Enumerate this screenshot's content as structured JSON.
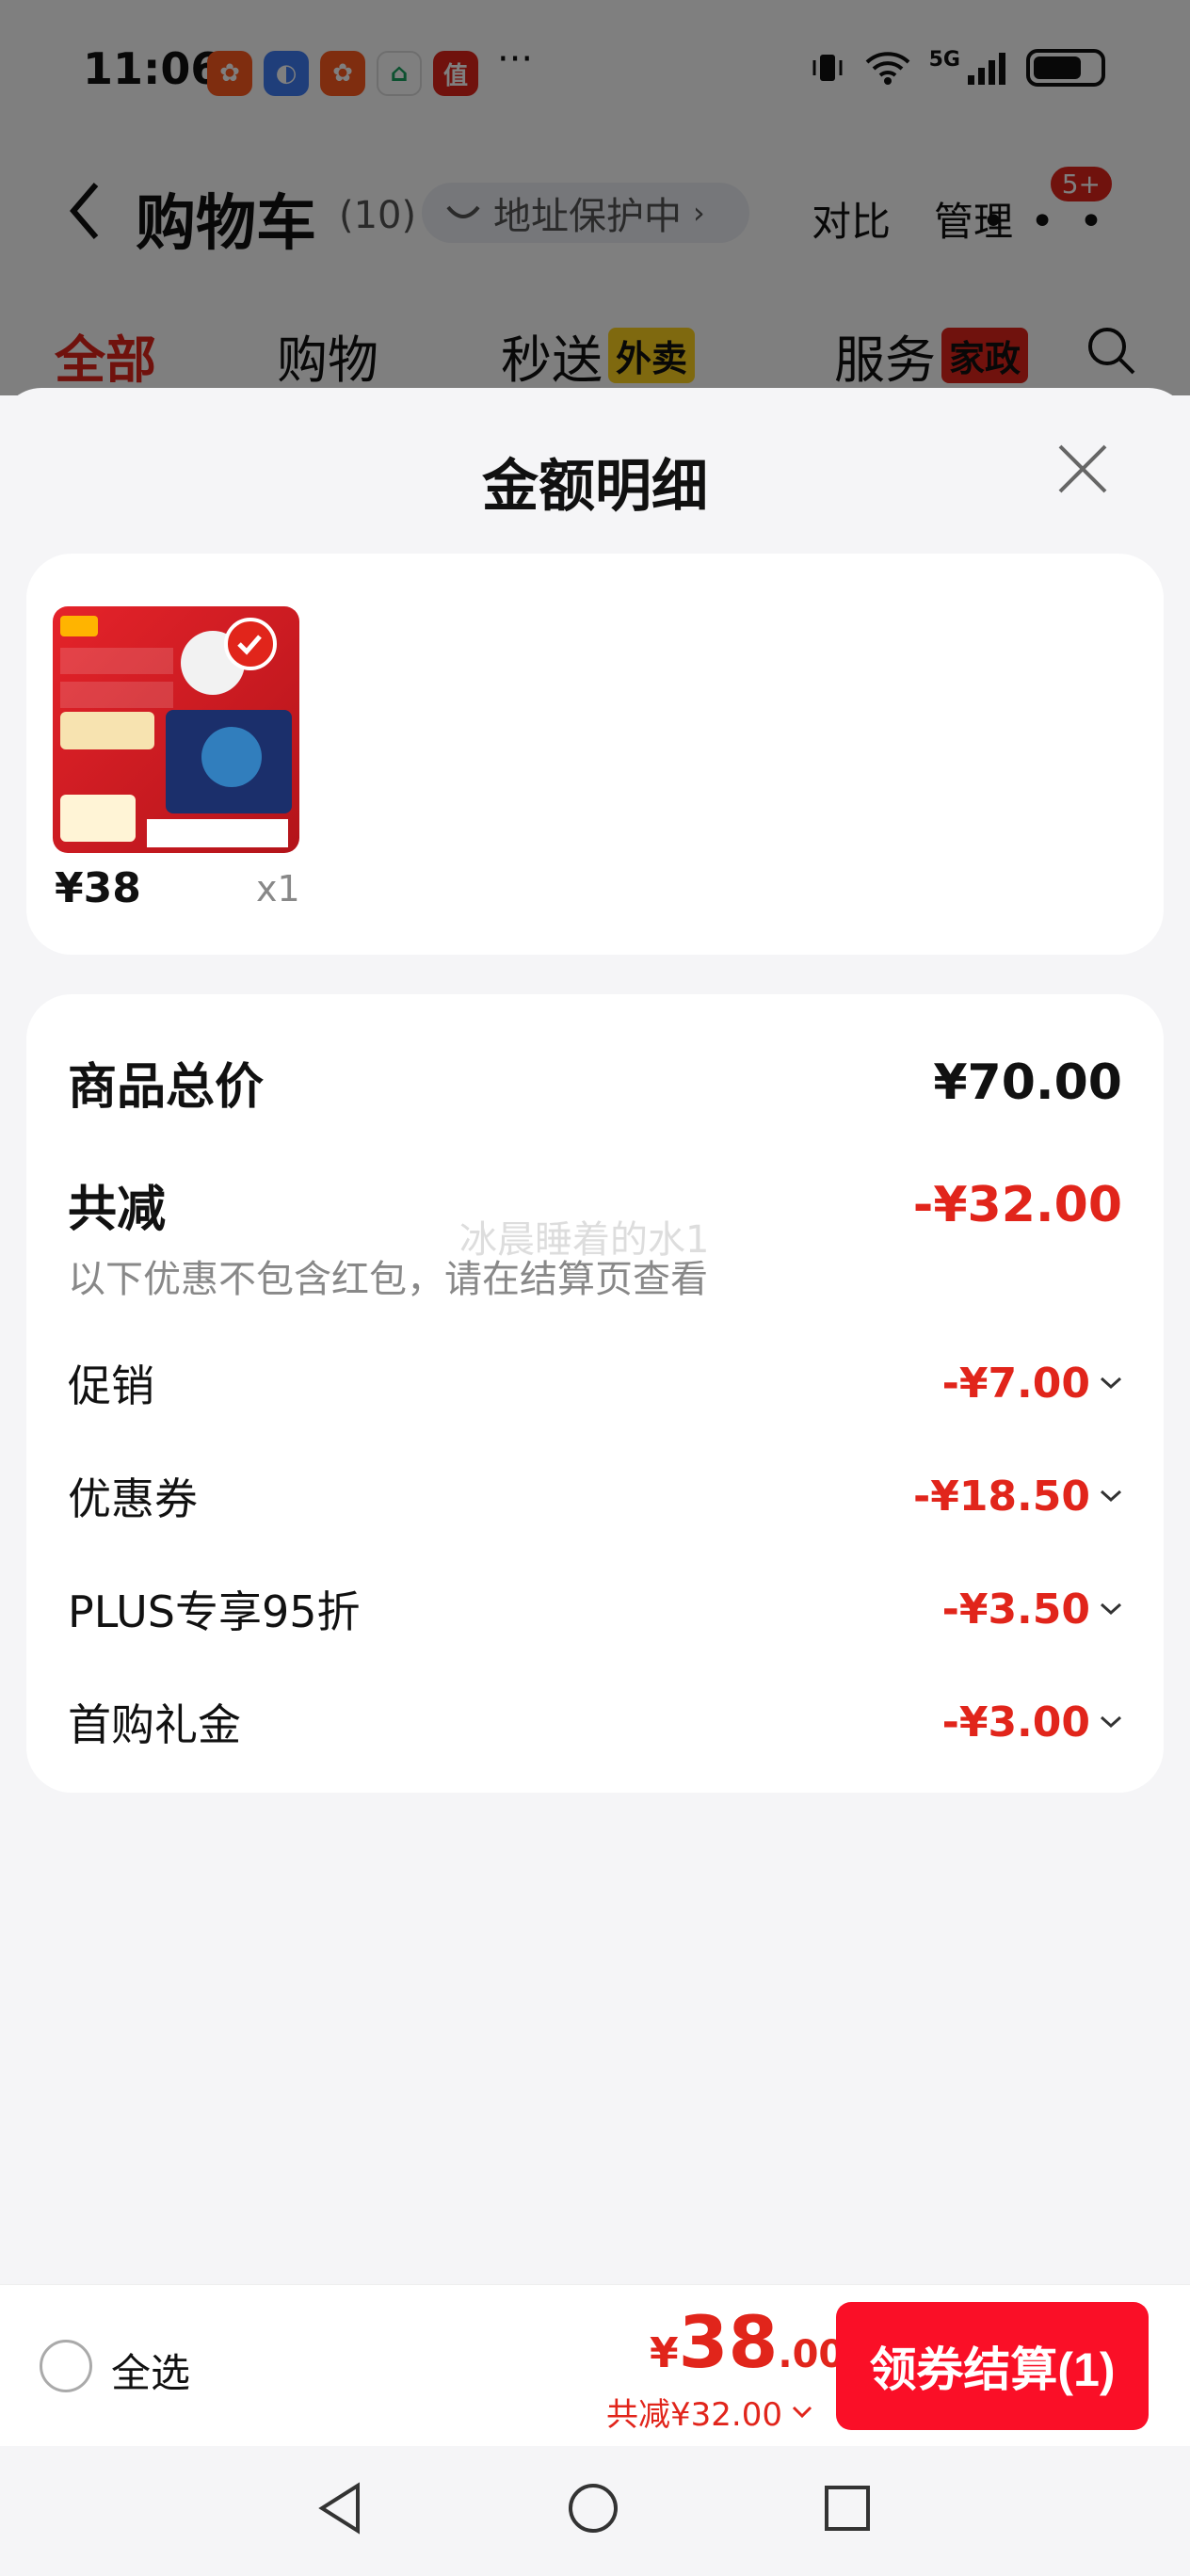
{
  "status_bar": {
    "time": "11:06",
    "more": "···",
    "network": "5G"
  },
  "header": {
    "title": "购物车",
    "count": "(10)",
    "address_protect": "地址保护中",
    "compare": "对比",
    "manage": "管理",
    "badge": "5+"
  },
  "tabs": [
    {
      "label": "全部"
    },
    {
      "label": "购物"
    },
    {
      "label": "秒送",
      "tag": "外卖"
    },
    {
      "label": "服务",
      "tag": "家政"
    }
  ],
  "sheet": {
    "title": "金额明细",
    "product": {
      "price": "¥38",
      "qty": "x1"
    },
    "watermark": "冰晨睡着的水1",
    "summary": {
      "total_label": "商品总价",
      "total_value": "¥70.00",
      "reduce_label": "共减",
      "reduce_value": "-¥32.00",
      "note": "以下优惠不包含红包，请在结算页查看"
    },
    "discounts": [
      {
        "label": "促销",
        "value": "-¥7.00"
      },
      {
        "label": "优惠券",
        "value": "-¥18.50"
      },
      {
        "label": "PLUS专享95折",
        "value": "-¥3.50"
      },
      {
        "label": "首购礼金",
        "value": "-¥3.00"
      }
    ]
  },
  "bottom_bar": {
    "select_all": "全选",
    "currency": "¥",
    "total_int": "38",
    "total_dec": ".00",
    "reduce_text": "共减¥32.00",
    "checkout": "领券结算(1)"
  },
  "colors": {
    "accent": "#e1251b",
    "button": "#fa0f27",
    "yellow_tag": "#ffd21e"
  }
}
